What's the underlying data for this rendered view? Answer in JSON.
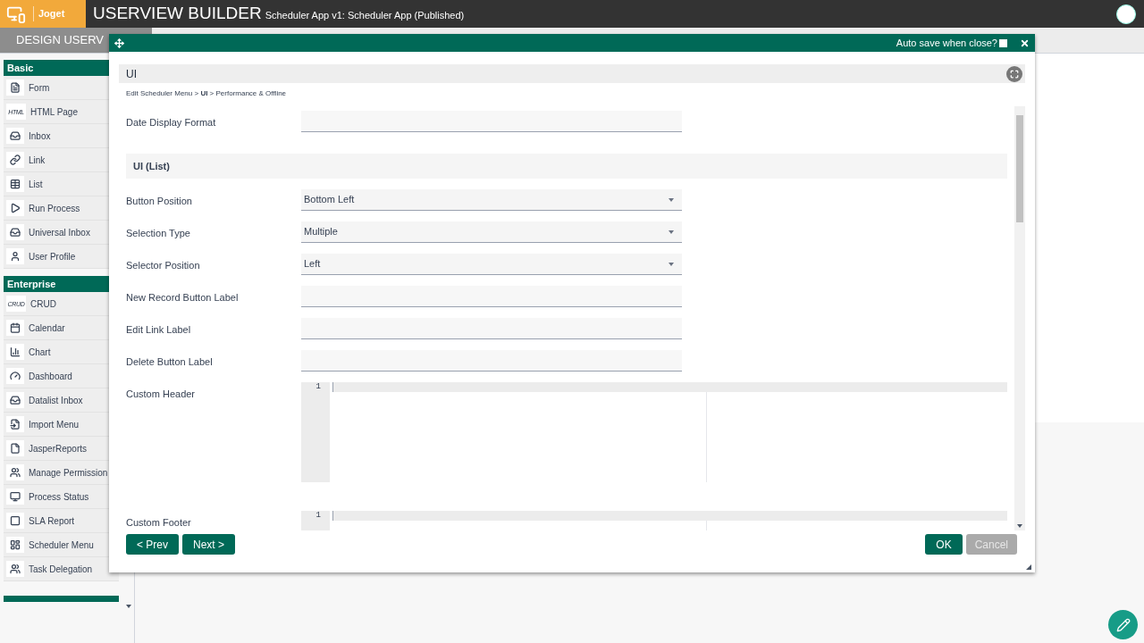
{
  "header": {
    "brand": "Joget",
    "title": "USERVIEW BUILDER",
    "subtitle": "Scheduler App v1: Scheduler App (Published)"
  },
  "tab": {
    "label": "DESIGN USERV"
  },
  "sidebar": [
    {
      "title": "Basic",
      "items": [
        {
          "label": "Form",
          "kind": "form"
        },
        {
          "label": "HTML Page",
          "kind": "text",
          "icon_text": "HTML"
        },
        {
          "label": "Inbox",
          "kind": "inbox"
        },
        {
          "label": "Link",
          "kind": "link"
        },
        {
          "label": "List",
          "kind": "table"
        },
        {
          "label": "Run Process",
          "kind": "play"
        },
        {
          "label": "Universal Inbox",
          "kind": "inbox"
        },
        {
          "label": "User Profile",
          "kind": "user"
        }
      ]
    },
    {
      "title": "Enterprise",
      "items": [
        {
          "label": "CRUD",
          "kind": "text",
          "icon_text": "CRUD"
        },
        {
          "label": "Calendar",
          "kind": "calendar"
        },
        {
          "label": "Chart",
          "kind": "chart"
        },
        {
          "label": "Dashboard",
          "kind": "gauge"
        },
        {
          "label": "Datalist Inbox",
          "kind": "inbox"
        },
        {
          "label": "Import Menu",
          "kind": "import"
        },
        {
          "label": "JasperReports",
          "kind": "file"
        },
        {
          "label": "Manage Permission",
          "kind": "users"
        },
        {
          "label": "Process Status",
          "kind": "monitor"
        },
        {
          "label": "SLA Report",
          "kind": "square"
        },
        {
          "label": "Scheduler Menu",
          "kind": "scheduler"
        },
        {
          "label": "Task Delegation",
          "kind": "users"
        }
      ]
    }
  ],
  "dialog": {
    "auto_save_label": "Auto save when close?",
    "auto_save_checked": false,
    "panel_title": "UI",
    "breadcrumb": "Edit Scheduler Menu > **UI** > Performance & Offline",
    "fields": [
      {
        "kind": "text",
        "label": "Date Display Format"
      },
      {
        "kind": "section",
        "label": "UI (List)"
      },
      {
        "kind": "select",
        "label": "Button Position",
        "value": "Bottom Left"
      },
      {
        "kind": "select",
        "label": "Selection Type",
        "value": "Multiple"
      },
      {
        "kind": "select",
        "label": "Selector Position",
        "value": "Left"
      },
      {
        "kind": "text",
        "label": "New Record Button Label"
      },
      {
        "kind": "text",
        "label": "Edit Link Label"
      },
      {
        "kind": "text",
        "label": "Delete Button Label"
      },
      {
        "kind": "code",
        "label": "Custom Header",
        "line": "1"
      },
      {
        "kind": "code",
        "label": "Custom Footer",
        "line": "1"
      }
    ],
    "buttons_left": [
      "< Prev",
      "Next >"
    ],
    "ok": "OK",
    "cancel": "Cancel",
    "cancel_disabled": true
  }
}
